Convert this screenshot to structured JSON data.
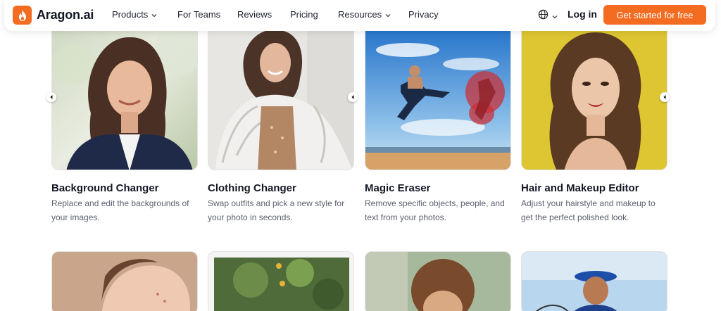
{
  "header": {
    "brand": "Aragon.ai",
    "nav": [
      {
        "label": "Products",
        "dropdown": true
      },
      {
        "label": "For Teams",
        "dropdown": false
      },
      {
        "label": "Reviews",
        "dropdown": false
      },
      {
        "label": "Pricing",
        "dropdown": false
      },
      {
        "label": "Resources",
        "dropdown": true
      },
      {
        "label": "Privacy",
        "dropdown": false
      }
    ],
    "login_label": "Log in",
    "cta_label": "Get started for free"
  },
  "cards_row1": [
    {
      "title": "Background Changer",
      "desc": "Replace and edit the backgrounds of your images."
    },
    {
      "title": "Clothing Changer",
      "desc": "Swap outfits and pick a new style for your photo in seconds."
    },
    {
      "title": "Magic Eraser",
      "desc": "Remove specific objects, people, and text from your photos."
    },
    {
      "title": "Hair and Makeup Editor",
      "desc": "Adjust your hairstyle and makeup to get the perfect polished look."
    }
  ],
  "colors": {
    "brand": "#f36c21",
    "text": "#1f2330",
    "muted": "#5b6070"
  },
  "icons": [
    "flame-logo-icon",
    "globe-icon",
    "chevron-down-icon",
    "carousel-arrow-icon"
  ]
}
